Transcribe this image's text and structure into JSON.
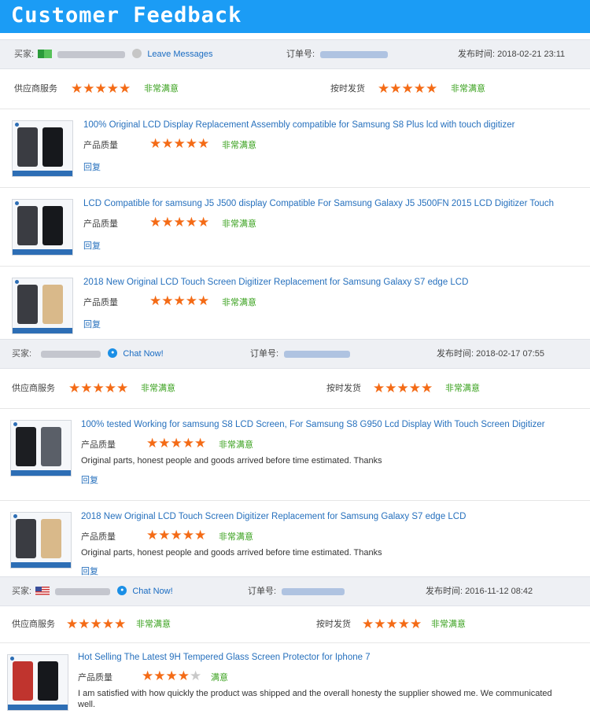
{
  "banner": {
    "title": "Customer Feedback"
  },
  "labels": {
    "buyer": "买家:",
    "order_no": "订单号:",
    "published": "发布时间:",
    "supplier_service": "供应商服务",
    "on_time_delivery": "按时发货",
    "product_quality": "产品质量",
    "reply": "回复"
  },
  "orders": [
    {
      "contact_link": "Leave Messages",
      "published_time": "2018-02-21 23:11",
      "supplier_rating": 5,
      "supplier_praise": "非常满意",
      "delivery_rating": 5,
      "delivery_praise": "非常满意",
      "items": [
        {
          "title": "100% Original LCD Display Replacement Assembly compatible for Samsung S8 Plus lcd with touch digitizer",
          "quality_rating": 5,
          "quality_praise": "非常满意",
          "comment": ""
        },
        {
          "title": "LCD Compatible for samsung J5 J500 display Compatible For Samsung Galaxy J5 J500FN 2015 LCD Digitizer Touch",
          "quality_rating": 5,
          "quality_praise": "非常满意",
          "comment": ""
        },
        {
          "title": "2018 New Original LCD Touch Screen Digitizer Replacement for Samsung Galaxy S7 edge LCD",
          "quality_rating": 5,
          "quality_praise": "非常满意",
          "comment": ""
        }
      ]
    },
    {
      "contact_link": "Chat Now!",
      "published_time": "2018-02-17 07:55",
      "supplier_rating": 5,
      "supplier_praise": "非常满意",
      "delivery_rating": 5,
      "delivery_praise": "非常满意",
      "items": [
        {
          "title": "100% tested Working for samsung S8 LCD Screen, For Samsung S8 G950 Lcd Display With Touch Screen Digitizer",
          "quality_rating": 5,
          "quality_praise": "非常满意",
          "comment": "Original parts, honest people and goods arrived before time estimated. Thanks"
        },
        {
          "title": "2018 New Original LCD Touch Screen Digitizer Replacement for Samsung Galaxy S7 edge LCD",
          "quality_rating": 5,
          "quality_praise": "非常满意",
          "comment": "Original parts, honest people and goods arrived before time estimated. Thanks"
        }
      ]
    },
    {
      "contact_link": "Chat Now!",
      "published_time": "2016-11-12 08:42",
      "supplier_rating": 5,
      "supplier_praise": "非常满意",
      "delivery_rating": 5,
      "delivery_praise": "非常满意",
      "items": [
        {
          "title": "Hot Selling The Latest 9H Tempered Glass Screen Protector for Iphone 7",
          "quality_rating": 4,
          "quality_praise": "满意",
          "comment": "I am satisfied with how quickly the product was shipped and the overall honesty the supplier showed me. We communicated well."
        }
      ]
    }
  ],
  "colors": {
    "banner": "#1b9cf5",
    "star": "#f46b16",
    "praise": "#3aa11e",
    "link": "#2670bd"
  }
}
